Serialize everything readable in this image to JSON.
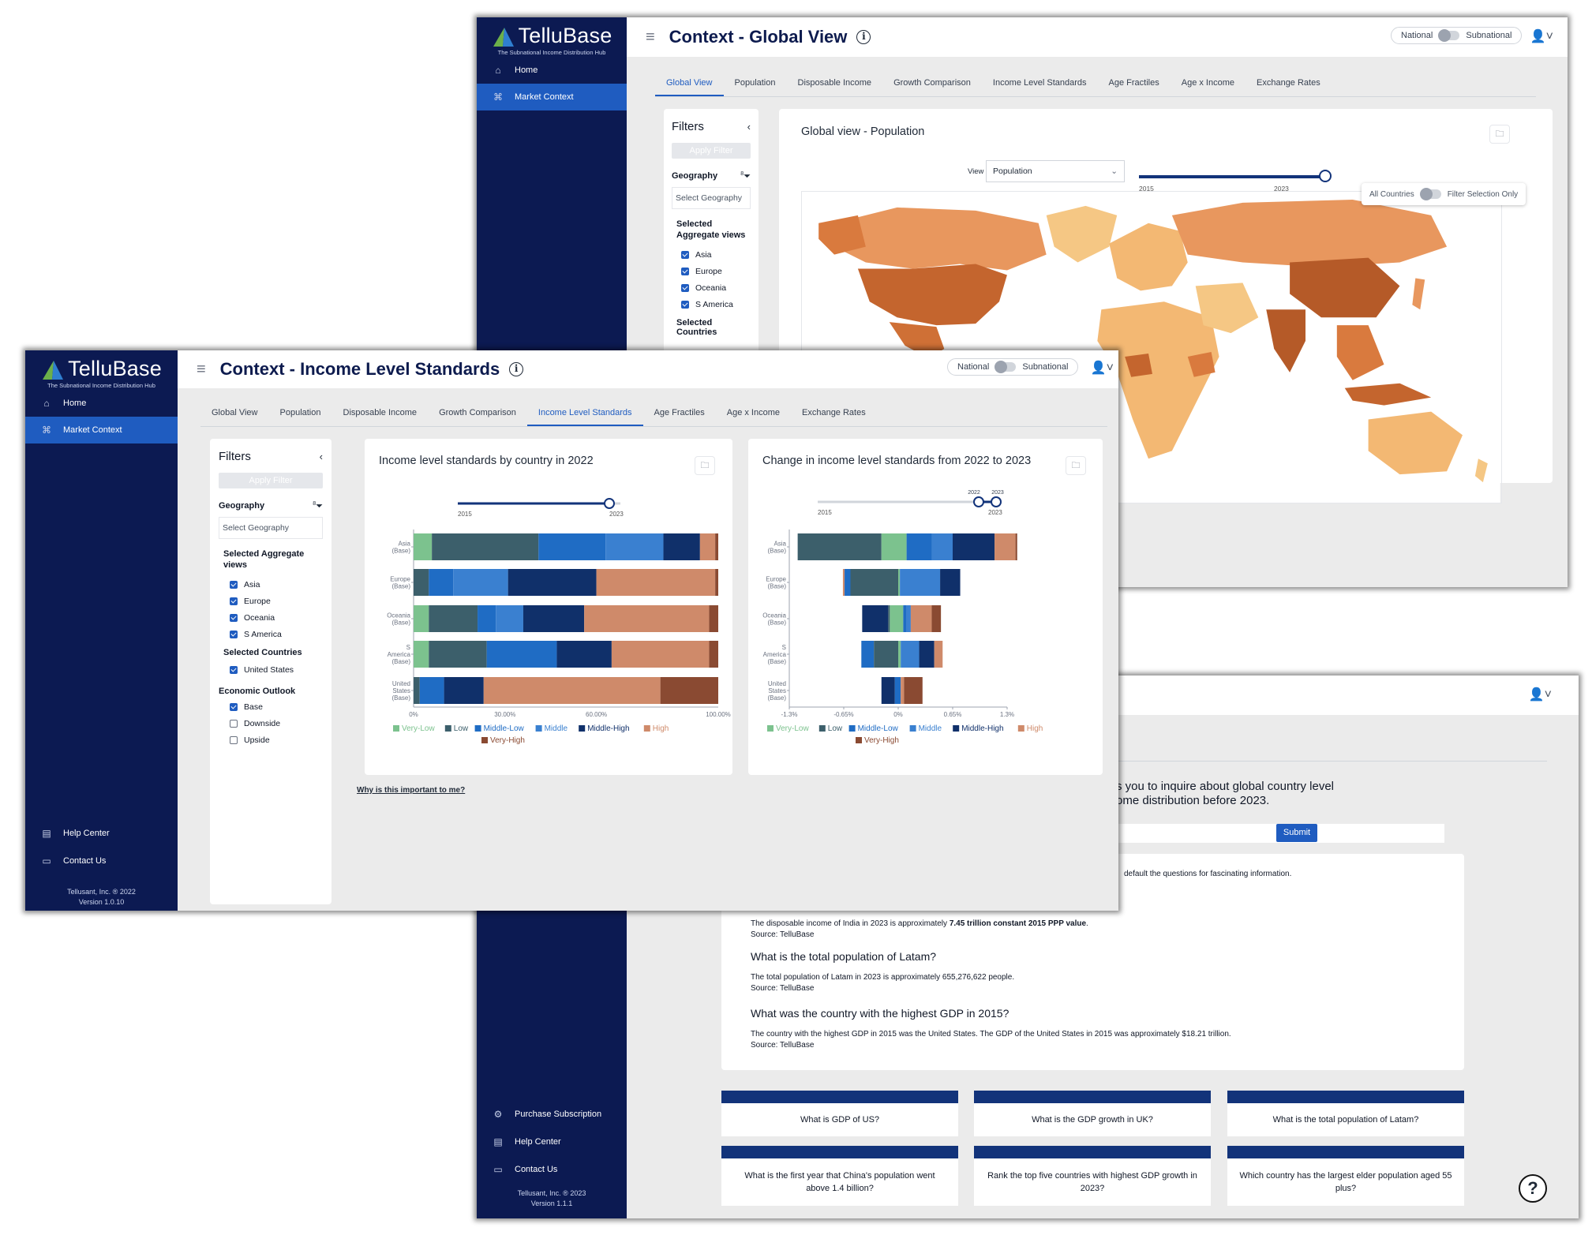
{
  "app": {
    "brand": "TelluBase",
    "tagline": "The Subnational Income Distribution Hub",
    "nav": {
      "home": "Home",
      "market_context": "Market Context"
    }
  },
  "global_window": {
    "title": "Context - Global View",
    "toggle": {
      "left": "National",
      "right": "Subnational"
    },
    "tabs": [
      "Global View",
      "Population",
      "Disposable Income",
      "Growth Comparison",
      "Income Level Standards",
      "Age Fractiles",
      "Age x Income",
      "Exchange Rates"
    ],
    "active_tab": "Global View",
    "filters": {
      "title": "Filters",
      "apply": "Apply Filter",
      "geography_label": "Geography",
      "geography_count": "8",
      "geography_placeholder": "Select Geography",
      "aggregate_label": "Selected Aggregate views",
      "aggregates": [
        "Asia",
        "Europe",
        "Oceania",
        "S America"
      ],
      "countries_label": "Selected Countries"
    },
    "map_card": {
      "title": "Global view - Population",
      "view_label": "View",
      "view_value": "Population",
      "year_min": "2015",
      "year_max": "2023",
      "year_selected": 2023,
      "scope_left": "All Countries",
      "scope_right": "Filter Selection Only"
    }
  },
  "income_window": {
    "title": "Context - Income Level Standards",
    "toggle": {
      "left": "National",
      "right": "Subnational"
    },
    "tabs": [
      "Global View",
      "Population",
      "Disposable Income",
      "Growth Comparison",
      "Income Level Standards",
      "Age Fractiles",
      "Age x Income",
      "Exchange Rates"
    ],
    "active_tab": "Income Level Standards",
    "filters": {
      "title": "Filters",
      "apply": "Apply Filter",
      "geography_label": "Geography",
      "geography_count": "8",
      "geography_placeholder": "Select Geography",
      "aggregate_label": "Selected Aggregate views",
      "aggregates": [
        "Asia",
        "Europe",
        "Oceania",
        "S America"
      ],
      "countries_label": "Selected Countries",
      "countries": [
        "United States"
      ],
      "outlook_label": "Economic Outlook",
      "outlook": [
        {
          "label": "Base",
          "checked": true
        },
        {
          "label": "Downside",
          "checked": false
        },
        {
          "label": "Upside",
          "checked": false
        }
      ]
    },
    "why_link": "Why is this important to me?",
    "sidebar_footer": {
      "help": "Help Center",
      "contact": "Contact Us",
      "copyright": "Tellusant, Inc. ® 2022",
      "version": "Version 1.0.10"
    }
  },
  "qa_window": {
    "intro_line1": "s you to inquire about global country level",
    "intro_line2": "ome distribution before 2023.",
    "submit": "Submit",
    "hint": "default the questions for fascinating information.",
    "answers": [
      {
        "question": "",
        "answer_pre": "The disposable income of India in 2023 is approximately ",
        "answer_bold": "7.45 trillion constant 2015 PPP value",
        "answer_post": ".",
        "source": "Source: TelluBase"
      },
      {
        "question": "What is the total population of Latam?",
        "answer_pre": "The total population of Latam in 2023 is approximately 655,276,622 people.",
        "answer_bold": "",
        "answer_post": "",
        "source": "Source: TelluBase"
      },
      {
        "question": "What was the country with the highest GDP in 2015?",
        "answer_pre": "The country with the highest GDP in 2015 was the United States. The GDP of the United States in 2015 was approximately $18.21 trillion.",
        "answer_bold": "",
        "answer_post": "",
        "source": "Source: TelluBase"
      }
    ],
    "suggestions": [
      "What is GDP of US?",
      "What is the GDP growth in UK?",
      "What is the total population of Latam?",
      "What is the first year that China's population went above 1.4 billion?",
      "Rank the top five countries with highest GDP growth in 2023?",
      "Which country has the largest elder population aged 55 plus?"
    ],
    "sidebar_footer": {
      "purchase": "Purchase Subscription",
      "help": "Help Center",
      "contact": "Contact Us",
      "copyright": "Tellusant, Inc. ® 2023",
      "version": "Version 1.1.1"
    }
  },
  "chart_data": [
    {
      "type": "bar",
      "stacked": true,
      "orientation": "horizontal",
      "title": "Income level standards by country in 2022",
      "slider": {
        "min": "2015",
        "max": "2023"
      },
      "categories": [
        "Asia (Base)",
        "Europe (Base)",
        "Oceania (Base)",
        "S America (Base)",
        "United States (Base)"
      ],
      "category_lines": [
        [
          "Asia",
          "(Base)"
        ],
        [
          "Europe",
          "(Base)"
        ],
        [
          "Oceania",
          "(Base)"
        ],
        [
          "S",
          "America",
          "(Base)"
        ],
        [
          "United",
          "States",
          "(Base)"
        ]
      ],
      "xlim": [
        0,
        100
      ],
      "xticks": [
        "0%",
        "30.00%",
        "60.00%",
        "100.00%"
      ],
      "xtick_values": [
        0,
        30,
        60,
        100
      ],
      "series": [
        {
          "name": "Very-Low",
          "color": "#7cc28e",
          "values": [
            6,
            0,
            5,
            5,
            0
          ]
        },
        {
          "name": "Low",
          "color": "#3c5f6b",
          "values": [
            35,
            5,
            16,
            19,
            2
          ]
        },
        {
          "name": "Middle-Low",
          "color": "#1f6cc4",
          "values": [
            22,
            8,
            6,
            23,
            8
          ]
        },
        {
          "name": "Middle",
          "color": "#3a80d0",
          "values": [
            19,
            18,
            9,
            0,
            0
          ]
        },
        {
          "name": "Middle-High",
          "color": "#10306a",
          "values": [
            12,
            29,
            20,
            18,
            13
          ]
        },
        {
          "name": "High",
          "color": "#cf8a6a",
          "values": [
            5,
            39,
            41,
            32,
            58
          ]
        },
        {
          "name": "Very-High",
          "color": "#8a4a32",
          "values": [
            1,
            1,
            3,
            3,
            19
          ]
        }
      ]
    },
    {
      "type": "bar",
      "stacked": true,
      "orientation": "horizontal",
      "diverging": true,
      "title": "Change in income level standards from 2022 to 2023",
      "slider": {
        "min": "2015",
        "max": "2023",
        "from": "2022",
        "to": "2023"
      },
      "categories": [
        "Asia (Base)",
        "Europe (Base)",
        "Oceania (Base)",
        "S America (Base)",
        "United States (Base)"
      ],
      "category_lines": [
        [
          "Asia",
          "(Base)"
        ],
        [
          "Europe",
          "(Base)"
        ],
        [
          "Oceania",
          "(Base)"
        ],
        [
          "S",
          "America",
          "(Base)"
        ],
        [
          "United",
          "States",
          "(Base)"
        ]
      ],
      "xlim": [
        -1.3,
        1.3
      ],
      "xticks": [
        "-1.3%",
        "-0.65%",
        "0%",
        "0.65%",
        "1.3%"
      ],
      "xtick_values": [
        -1.3,
        -0.65,
        0,
        0.65,
        1.3
      ],
      "series_order": [
        "Low",
        "Very-Low",
        "Middle-Low",
        "Middle",
        "Middle-High",
        "High",
        "Very-High"
      ],
      "segments": [
        [
          [
            "Low",
            -1.2,
            -0.2
          ],
          [
            "Very-Low",
            -0.2,
            0.1
          ],
          [
            "Middle-Low",
            0.1,
            0.4
          ],
          [
            "Middle",
            0.4,
            0.65
          ],
          [
            "Middle-High",
            0.65,
            1.15
          ],
          [
            "High",
            1.15,
            1.4
          ],
          [
            "Very-High",
            1.4,
            1.42
          ]
        ],
        [
          [
            "High",
            -0.66,
            -0.64
          ],
          [
            "Middle-Low",
            -0.64,
            -0.57
          ],
          [
            "Low",
            -0.57,
            0.0
          ],
          [
            "Very-Low",
            0.0,
            0.02
          ],
          [
            "Middle",
            0.02,
            0.5
          ],
          [
            "Middle-High",
            0.5,
            0.74
          ]
        ],
        [
          [
            "Middle-High",
            -0.43,
            -0.12
          ],
          [
            "Low",
            -0.12,
            -0.1
          ],
          [
            "Very-Low",
            -0.1,
            0.06
          ],
          [
            "Middle-Low",
            0.06,
            0.1
          ],
          [
            "Middle",
            0.1,
            0.15
          ],
          [
            "High",
            0.15,
            0.4
          ],
          [
            "Very-High",
            0.4,
            0.51
          ]
        ],
        [
          [
            "Middle-Low",
            -0.44,
            -0.29
          ],
          [
            "Low",
            -0.29,
            0.0
          ],
          [
            "Very-Low",
            0.0,
            0.03
          ],
          [
            "Middle",
            0.03,
            0.25
          ],
          [
            "Middle-High",
            0.25,
            0.43
          ],
          [
            "High",
            0.43,
            0.53
          ]
        ],
        [
          [
            "Middle-High",
            -0.2,
            -0.04
          ],
          [
            "Middle-Low",
            -0.04,
            0.03
          ],
          [
            "High",
            0.03,
            0.07
          ],
          [
            "Very-High",
            0.07,
            0.29
          ]
        ]
      ]
    }
  ]
}
